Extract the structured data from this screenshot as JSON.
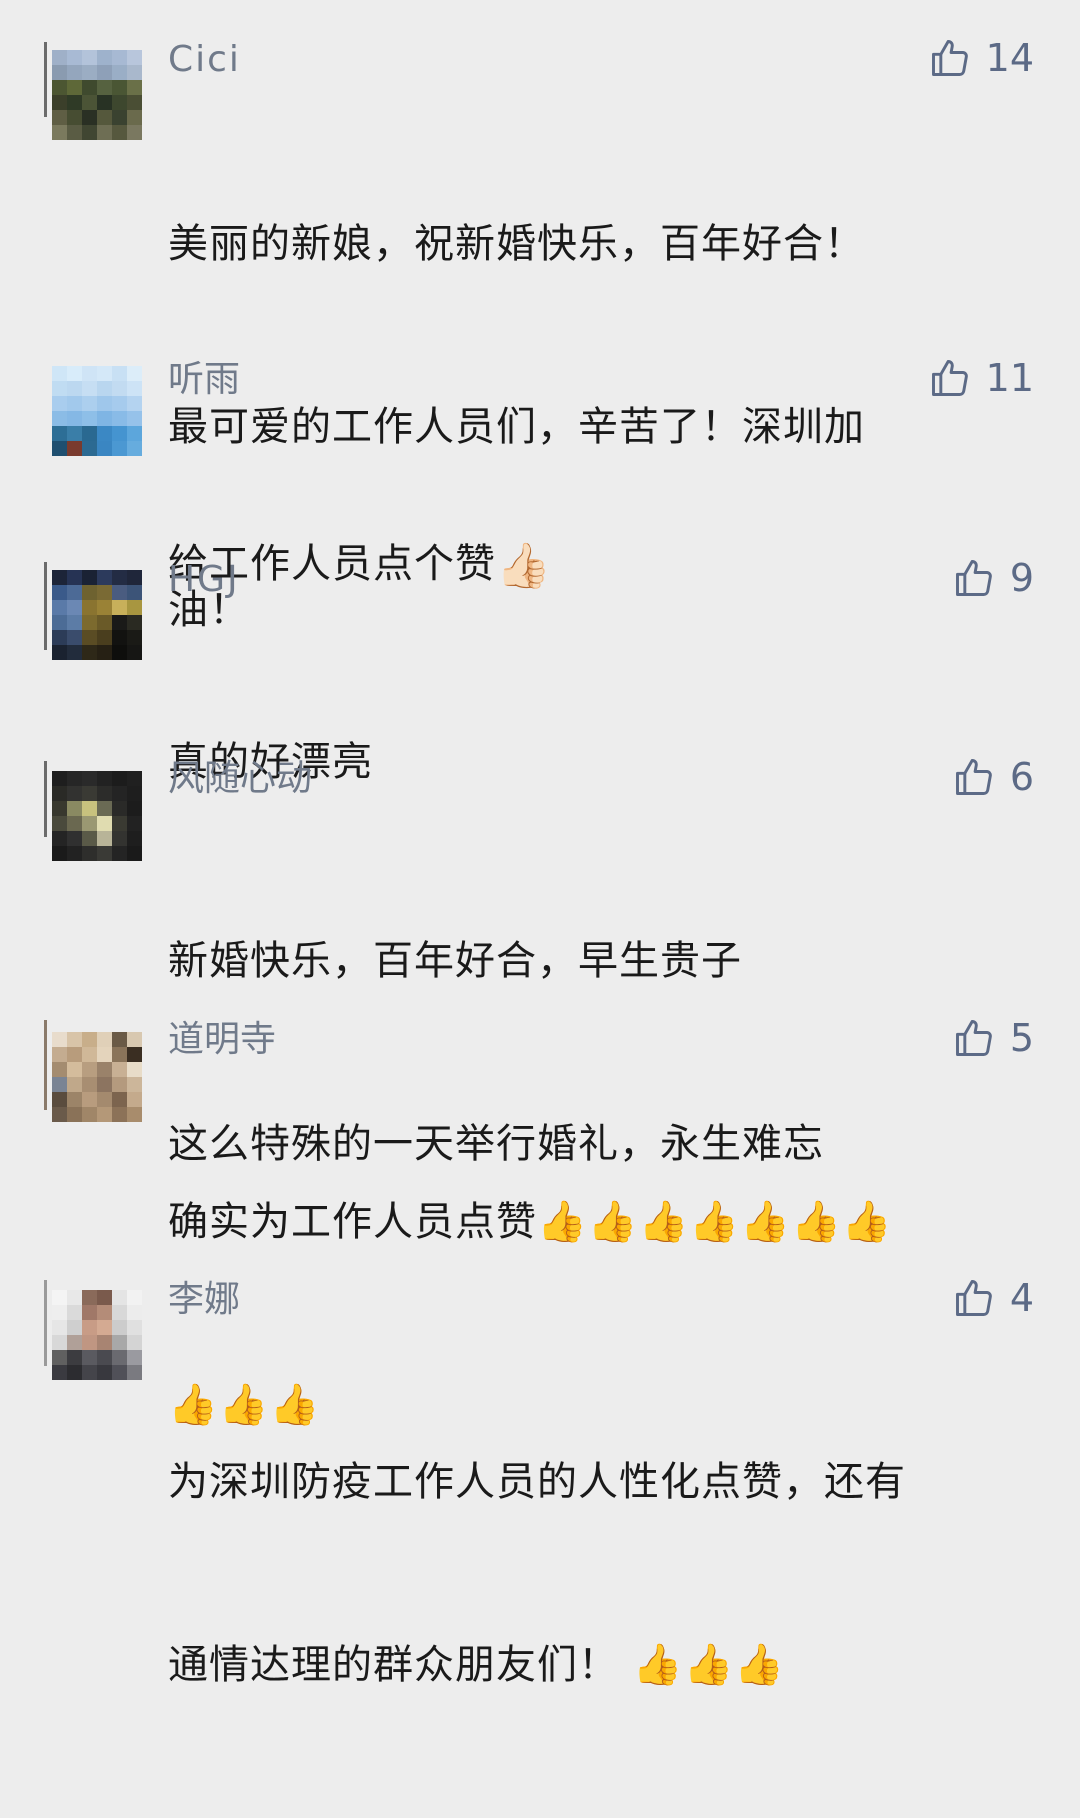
{
  "comments": [
    {
      "name": "Cici",
      "likes": "14",
      "lines": [
        "美丽的新娘，祝新婚快乐，百年好合！",
        "最可爱的工作人员们，辛苦了！深圳加",
        "油！"
      ],
      "emoji_suffix": ""
    },
    {
      "name": "听雨",
      "likes": "11",
      "lines": [
        "给工作人员点个赞"
      ],
      "emoji_suffix": "👍🏻"
    },
    {
      "name": "HGJ",
      "likes": "9",
      "lines": [
        "真的好漂亮"
      ],
      "emoji_suffix": ""
    },
    {
      "name": "风随心动",
      "likes": "6",
      "lines": [
        "新婚快乐，百年好合，早生贵子",
        "这么特殊的一天举行婚礼，永生难忘"
      ],
      "emoji_suffix": ""
    },
    {
      "name": "道明寺",
      "likes": "5",
      "lines": [
        "确实为工作人员点赞👍👍👍👍👍👍👍",
        "👍👍👍"
      ],
      "emoji_suffix": ""
    },
    {
      "name": "李娜",
      "likes": "4",
      "lines": [
        "为深圳防疫工作人员的人性化点赞，还有",
        "通情达理的群众朋友们！ 👍👍👍"
      ],
      "emoji_suffix": ""
    }
  ],
  "colors": {
    "background": "#ededed",
    "name": "#707a8a",
    "like": "#5c6a86",
    "text": "#1a1a1a"
  },
  "icons": {
    "like": "thumbs-up-outline-icon"
  }
}
